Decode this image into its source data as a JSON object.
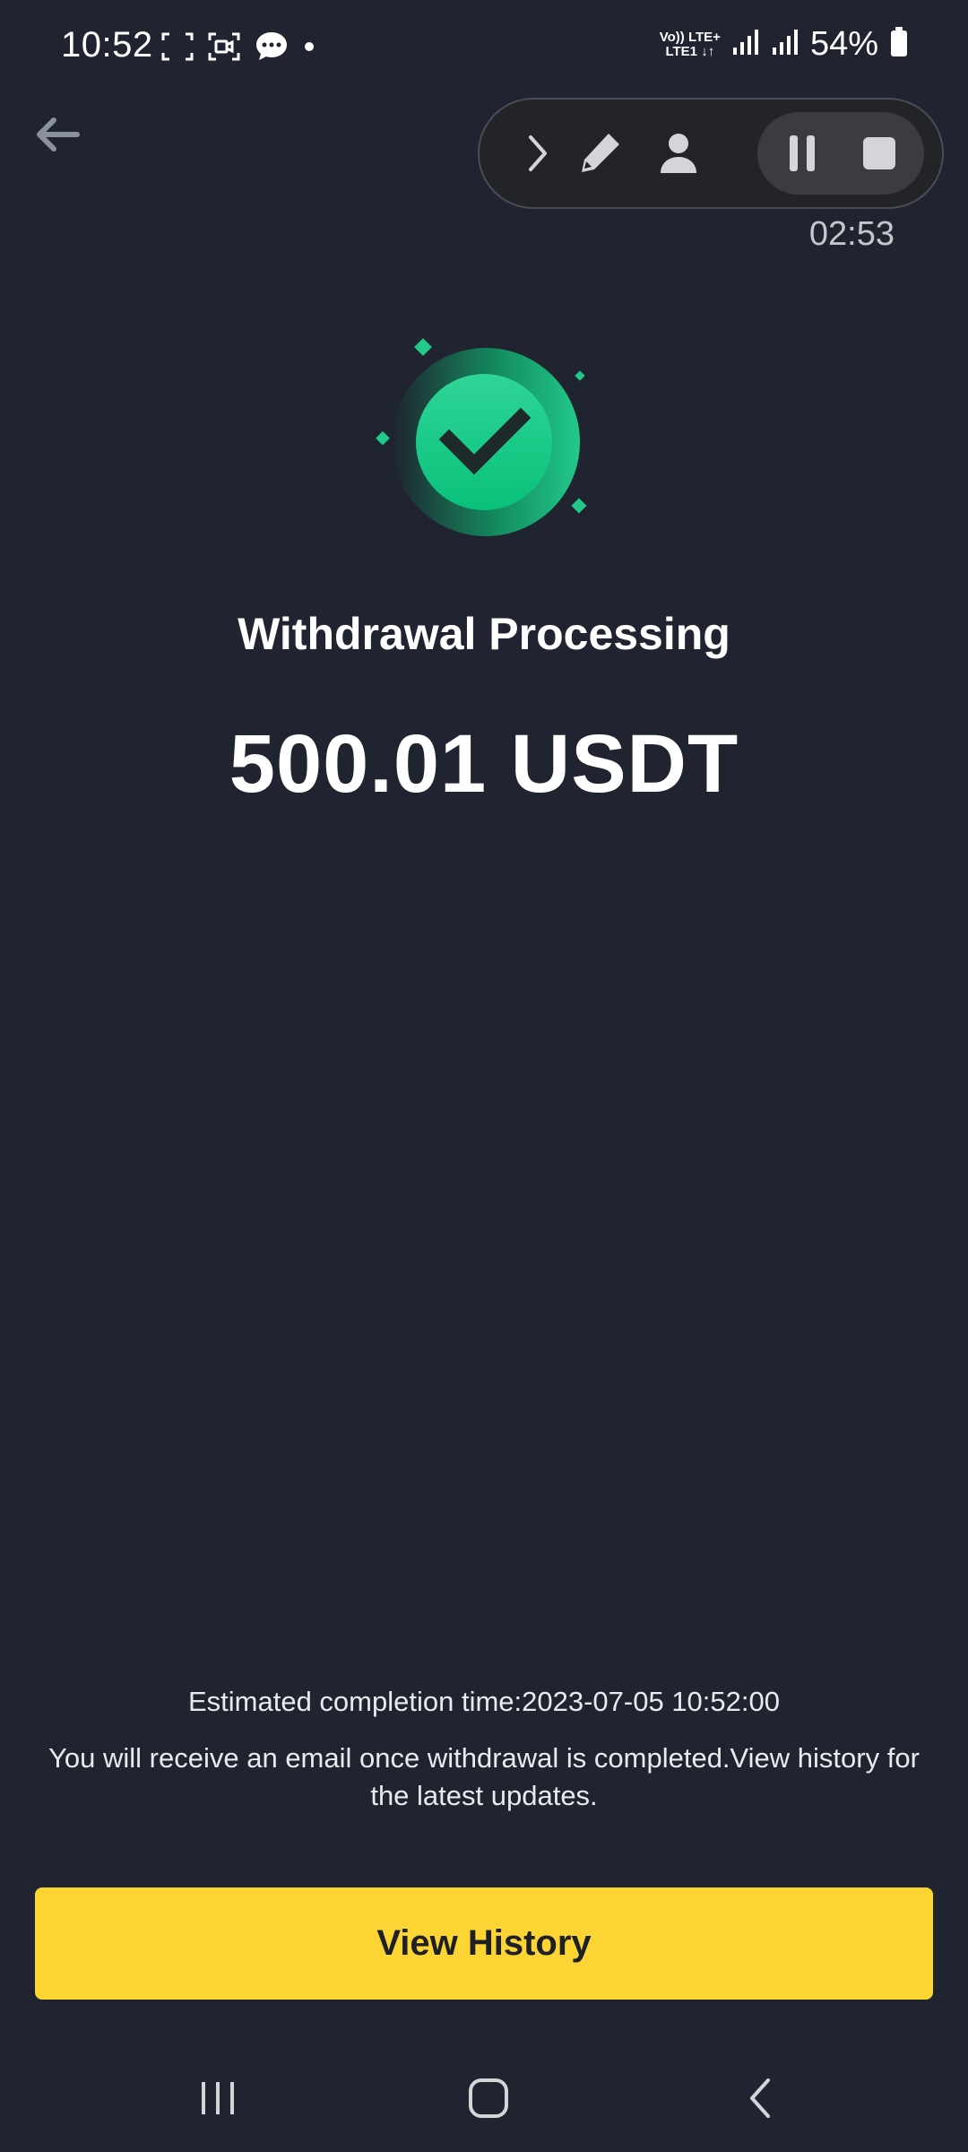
{
  "status_bar": {
    "time": "10:52",
    "net_top": "Vo)) LTE+",
    "net_bottom": "LTE1 ↓↑",
    "battery": "54%"
  },
  "recorder": {
    "timer": "02:53"
  },
  "result": {
    "title": "Withdrawal Processing",
    "amount": "500.01 USDT"
  },
  "info": {
    "estimated": "Estimated completion time:2023-07-05 10:52:00",
    "note": "You will receive an email once withdrawal is completed.View history for the latest updates."
  },
  "actions": {
    "view_history": "View History"
  },
  "colors": {
    "background": "#1f2430",
    "accent_yellow": "#fcd535",
    "success_green": "#0ecb81"
  }
}
